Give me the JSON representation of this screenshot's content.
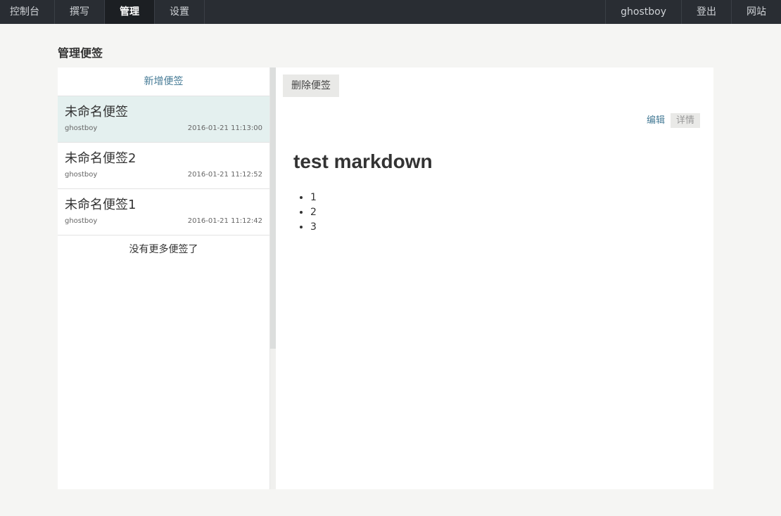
{
  "nav": {
    "left": [
      "控制台",
      "撰写",
      "管理",
      "设置"
    ],
    "right": [
      "ghostboy",
      "登出",
      "网站"
    ]
  },
  "page_title": "管理便签",
  "left_panel": {
    "add_label": "新增便签",
    "notes": [
      {
        "title": "未命名便签",
        "author": "ghostboy",
        "time": "2016-01-21 11:13:00"
      },
      {
        "title": "未命名便签2",
        "author": "ghostboy",
        "time": "2016-01-21 11:12:52"
      },
      {
        "title": "未命名便签1",
        "author": "ghostboy",
        "time": "2016-01-21 11:12:42"
      }
    ],
    "no_more": "没有更多便签了"
  },
  "right_panel": {
    "delete_label": "删除便签",
    "tabs": [
      "编辑",
      "详情"
    ],
    "content": {
      "heading": "test markdown",
      "list": [
        "1",
        "2",
        "3"
      ]
    }
  }
}
